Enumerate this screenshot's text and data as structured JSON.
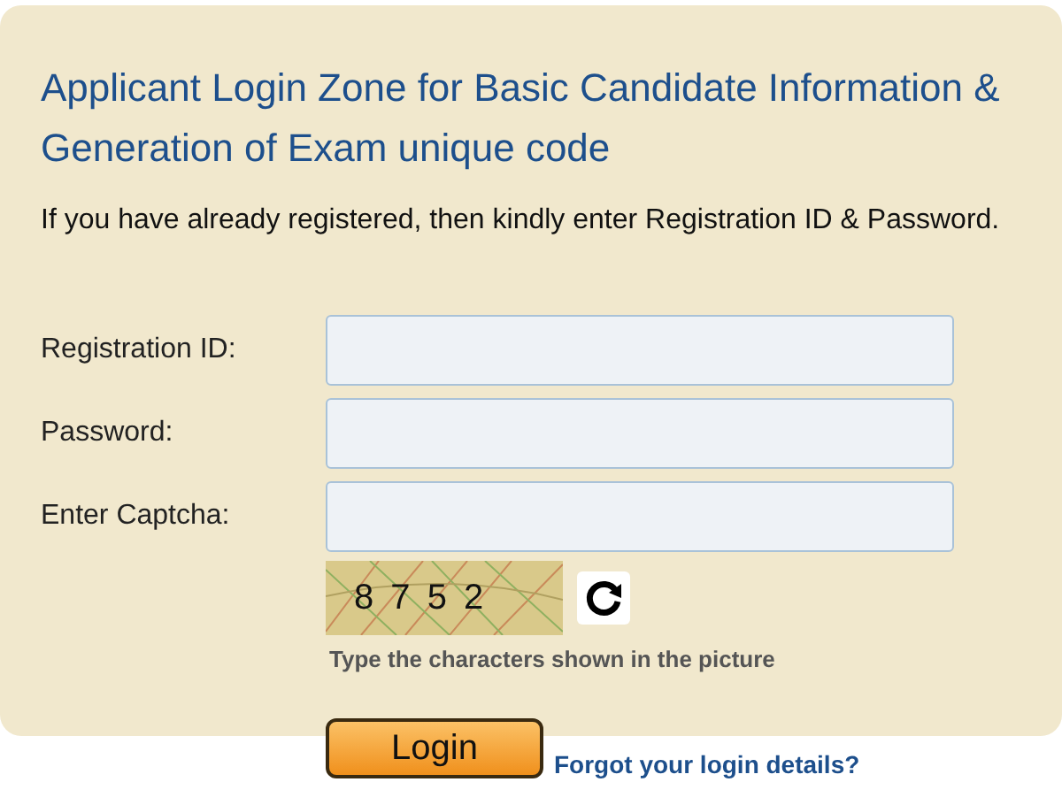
{
  "title": "Applicant Login Zone for Basic Candidate Information & Generation of Exam unique code",
  "intro": "If you have already registered, then kindly enter Registration ID & Password.",
  "fields": [
    {
      "label": "Registration ID:"
    },
    {
      "label": "Password:"
    },
    {
      "label": "Enter Captcha:"
    }
  ],
  "captcha": {
    "text": "8 7 5 2",
    "hint": "Type the characters shown in the picture"
  },
  "login_button": "Login",
  "forgot_link": "Forgot your login details?"
}
